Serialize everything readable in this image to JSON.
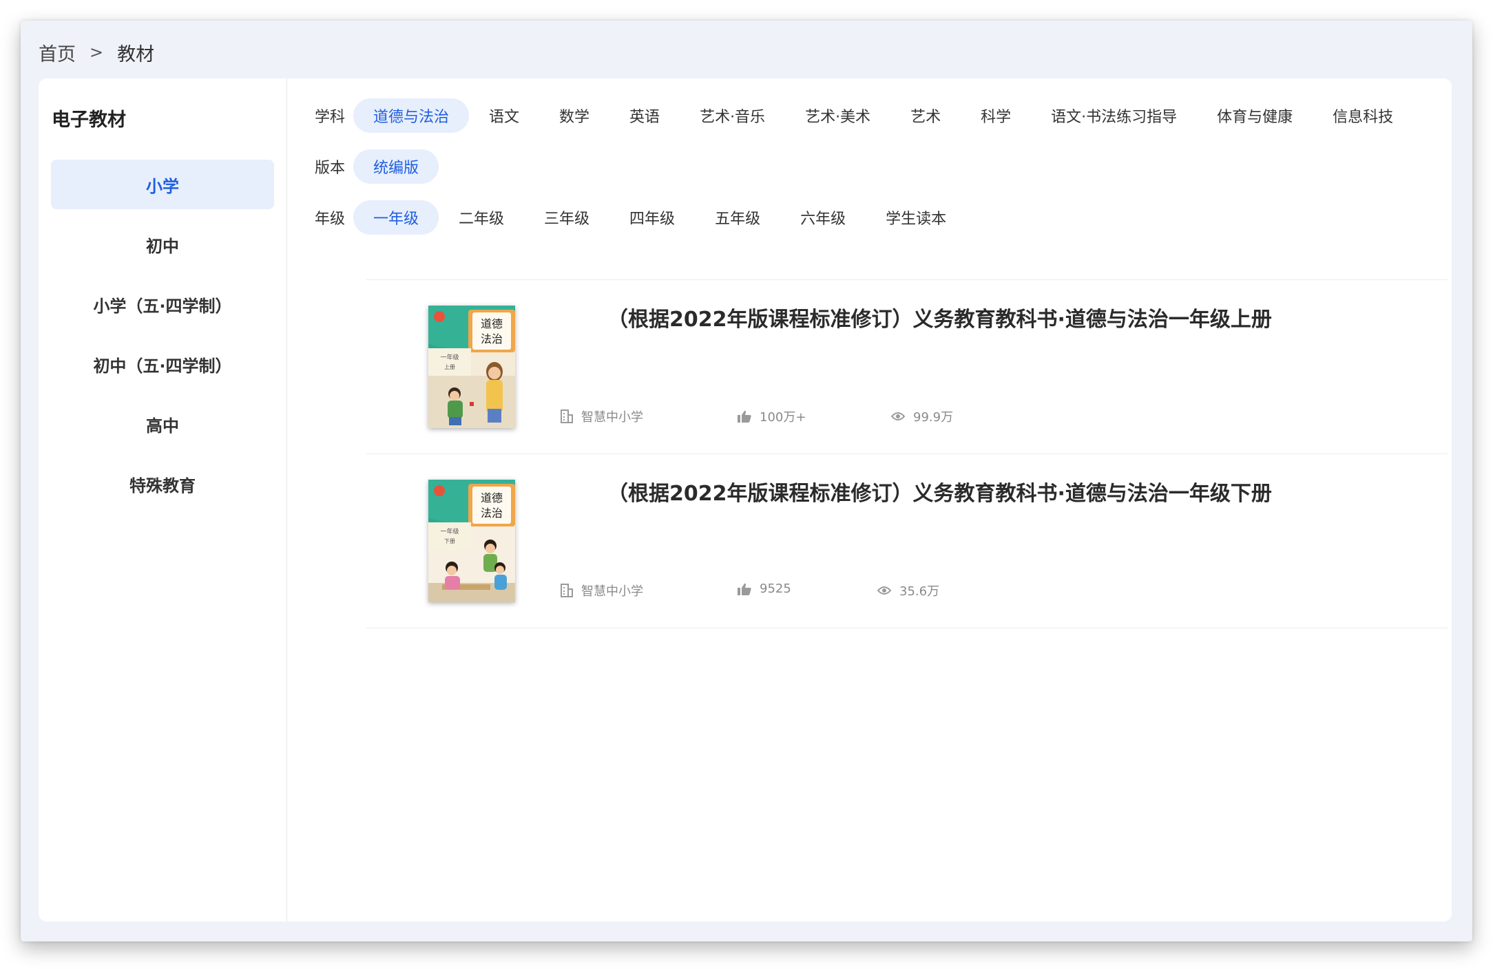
{
  "breadcrumb": {
    "home": "首页",
    "separator": ">",
    "current": "教材"
  },
  "sidebar": {
    "title": "电子教材",
    "stages": [
      {
        "label": "小学",
        "active": true
      },
      {
        "label": "初中",
        "active": false
      },
      {
        "label": "小学（五·四学制）",
        "active": false
      },
      {
        "label": "初中（五·四学制）",
        "active": false
      },
      {
        "label": "高中",
        "active": false
      },
      {
        "label": "特殊教育",
        "active": false
      }
    ]
  },
  "filters": {
    "subject": {
      "label": "学科",
      "options": [
        "道德与法治",
        "语文",
        "数学",
        "英语",
        "艺术·音乐",
        "艺术·美术",
        "艺术",
        "科学",
        "语文·书法练习指导",
        "体育与健康",
        "信息科技"
      ],
      "selected": "道德与法治"
    },
    "edition": {
      "label": "版本",
      "options": [
        "统编版"
      ],
      "selected": "统编版"
    },
    "grade": {
      "label": "年级",
      "options": [
        "一年级",
        "二年级",
        "三年级",
        "四年级",
        "五年级",
        "六年级",
        "学生读本"
      ],
      "selected": "一年级"
    }
  },
  "books": [
    {
      "title": "（根据2022年版课程标准修订）义务教育教科书·道德与法治一年级上册",
      "publisher": "智慧中小学",
      "likes": "100万+",
      "views": "99.9万",
      "cover": {
        "title_line1": "道德",
        "title_line2": "法治",
        "grade": "一年级",
        "volume": "上册"
      }
    },
    {
      "title": "（根据2022年版课程标准修订）义务教育教科书·道德与法治一年级下册",
      "publisher": "智慧中小学",
      "likes": "9525",
      "views": "35.6万",
      "cover": {
        "title_line1": "道德",
        "title_line2": "法治",
        "grade": "一年级",
        "volume": "下册"
      }
    }
  ],
  "colors": {
    "accent": "#1f5fe0",
    "chip_bg": "#e7eefc",
    "page_bg": "#eff2f8"
  },
  "icons": {
    "publisher": "building-icon",
    "likes": "thumbs-up-icon",
    "views": "eye-icon"
  }
}
